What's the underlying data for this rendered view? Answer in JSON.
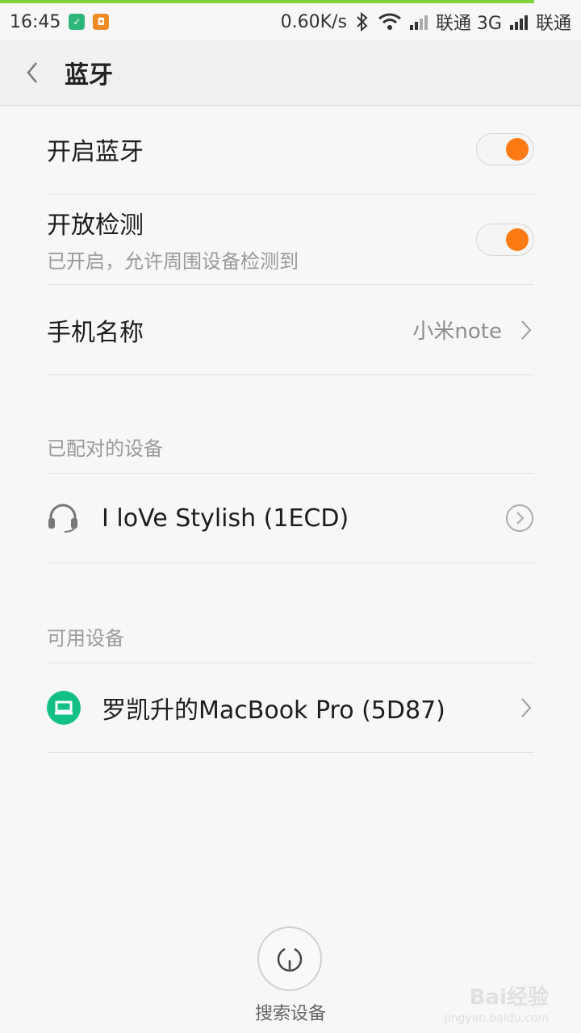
{
  "status_bar": {
    "time": "16:45",
    "net_speed": "0.60K/s",
    "carrier1": "联通 3G",
    "carrier2": "联通"
  },
  "header": {
    "title": "蓝牙"
  },
  "settings": {
    "bluetooth": {
      "label": "开启蓝牙",
      "enabled": true
    },
    "visibility": {
      "label": "开放检测",
      "sub": "已开启，允许周围设备检测到",
      "enabled": true
    },
    "device_name": {
      "label": "手机名称",
      "value": "小米note"
    }
  },
  "paired": {
    "section_label": "已配对的设备",
    "devices": [
      {
        "name": "I loVe Stylish (1ECD)",
        "icon": "headset-icon"
      }
    ]
  },
  "available": {
    "section_label": "可用设备",
    "devices": [
      {
        "name": "罗凯升的MacBook Pro (5D87)",
        "icon": "laptop-icon"
      }
    ]
  },
  "search": {
    "label": "搜索设备"
  },
  "watermark": {
    "text": "Bai经验",
    "sub": "jingyan.baidu.com"
  },
  "colors": {
    "accent": "#ff7a12",
    "device_green": "#12c087"
  }
}
